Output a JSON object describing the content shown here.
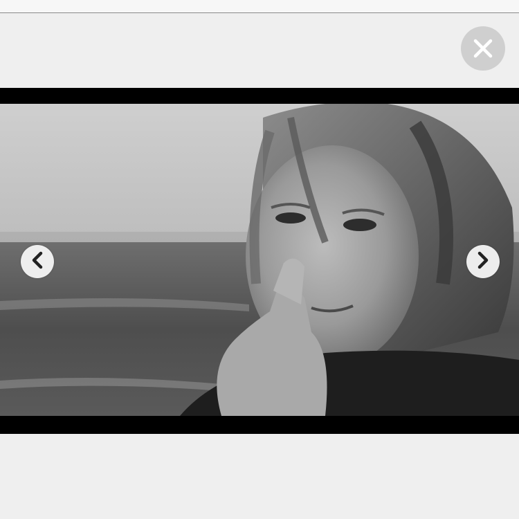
{
  "window": {
    "top_strip": "",
    "close": {
      "icon": "close-icon",
      "color": "#ffffff",
      "background": "#cfcfcf"
    }
  },
  "viewer": {
    "image": {
      "description_icon": "photo-image",
      "palette": "grayscale"
    },
    "prev": {
      "icon": "chevron-left-icon"
    },
    "next": {
      "icon": "chevron-right-icon"
    },
    "letterbox_color": "#000000"
  },
  "colors": {
    "page_background": "#efefef",
    "button_background": "#f5f5f5",
    "chevron": "#222222"
  }
}
